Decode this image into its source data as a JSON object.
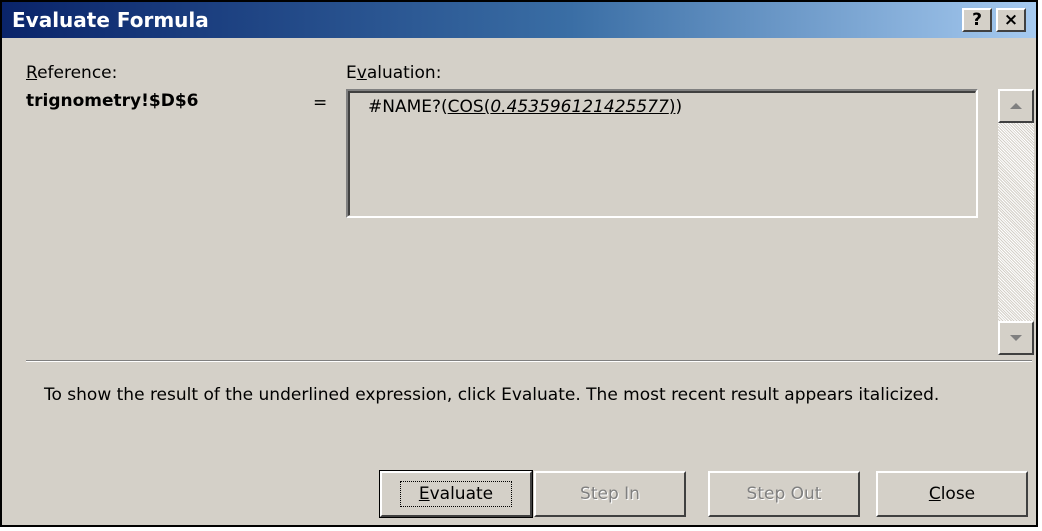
{
  "window": {
    "title": "Evaluate Formula"
  },
  "titlebar_buttons": {
    "help": "?",
    "close": "×"
  },
  "reference": {
    "label_prefix": "",
    "label_mnemonic": "R",
    "label_rest": "eference:",
    "value": "trignometry!$D$6"
  },
  "equals_sign": "=",
  "evaluation": {
    "label_prefix": "E",
    "label_mnemonic": "v",
    "label_rest": "aluation:",
    "expr_prefix": "#NAME?(",
    "expr_underlined_func": "COS(",
    "expr_underlined_italic": "0.453596121425577",
    "expr_underlined_close": ")",
    "expr_suffix": ")"
  },
  "instructions": "To show the result of the underlined expression, click Evaluate.  The most recent result appears italicized.",
  "buttons": {
    "evaluate": {
      "mnemonic": "E",
      "rest": "valuate"
    },
    "step_in": "Step In",
    "step_out": "Step Out",
    "close": {
      "mnemonic": "C",
      "rest": "lose"
    }
  },
  "icons": {
    "scroll_up": "scroll-up-arrow-icon",
    "scroll_down": "scroll-down-arrow-icon"
  },
  "colors": {
    "title_gradient_start": "#0a246a",
    "title_gradient_end": "#a6caf0",
    "face": "#d4d0c8",
    "disabled_text": "#808080"
  }
}
